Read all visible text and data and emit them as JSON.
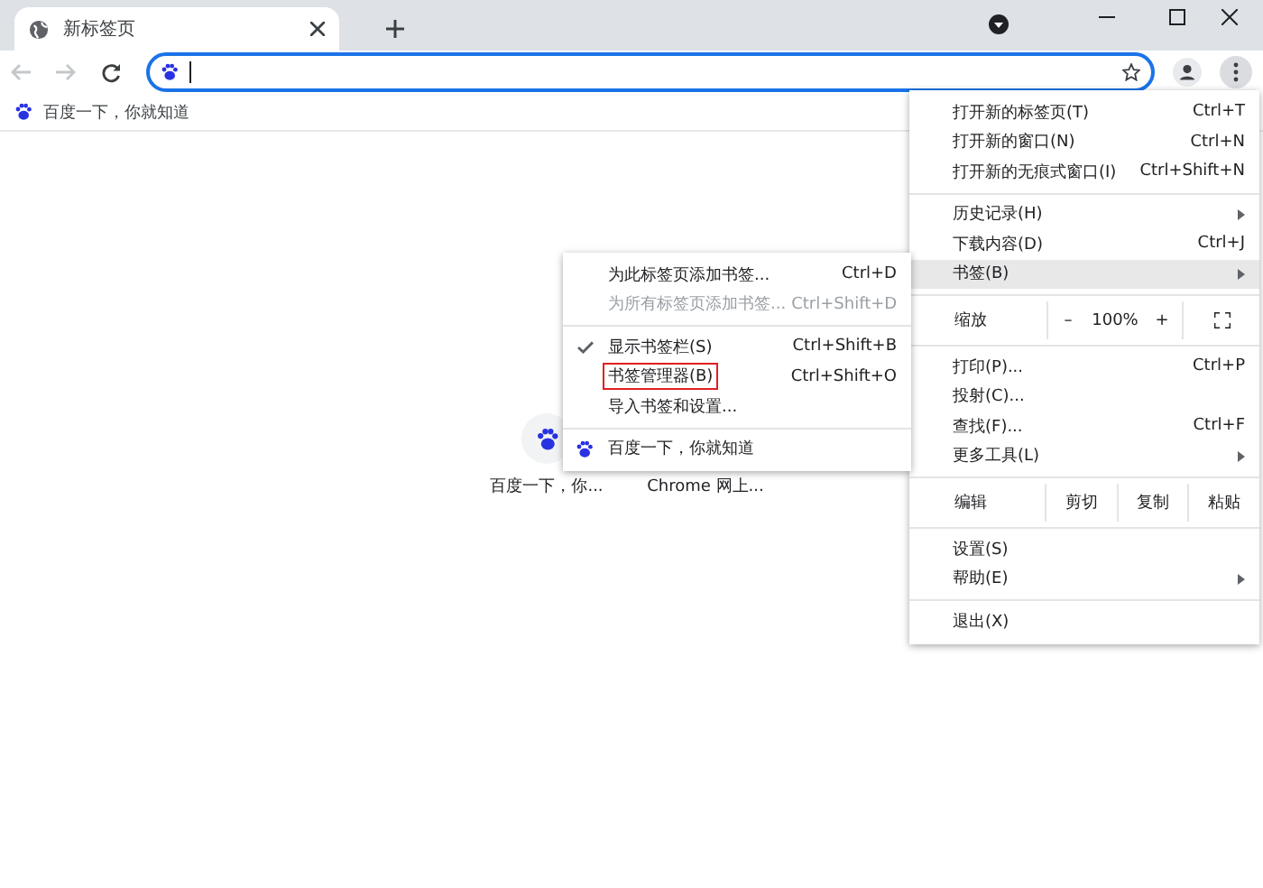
{
  "tabs": [
    {
      "title": "新标签页",
      "selected": true
    }
  ],
  "bookmarks_bar": [
    {
      "label": "百度一下，你就知道"
    }
  ],
  "shortcuts": [
    {
      "label": "百度一下，你...",
      "kind": "baidu"
    },
    {
      "label": "Chrome 网上...",
      "kind": "covered"
    }
  ],
  "main_menu": {
    "groups": [
      [
        {
          "kind": "item",
          "label": "打开新的标签页(T)",
          "shortcut": "Ctrl+T",
          "submenu": false,
          "highlighted": false
        },
        {
          "kind": "item",
          "label": "打开新的窗口(N)",
          "shortcut": "Ctrl+N",
          "submenu": false,
          "highlighted": false
        },
        {
          "kind": "item",
          "label": "打开新的无痕式窗口(I)",
          "shortcut": "Ctrl+Shift+N",
          "submenu": false,
          "highlighted": false
        }
      ],
      [
        {
          "kind": "item",
          "label": "历史记录(H)",
          "submenu": true,
          "highlighted": false
        },
        {
          "kind": "item",
          "label": "下载内容(D)",
          "shortcut": "Ctrl+J",
          "submenu": false,
          "highlighted": false
        },
        {
          "kind": "item",
          "label": "书签(B)",
          "submenu": true,
          "highlighted": true
        }
      ],
      [
        {
          "kind": "zoom",
          "label": "缩放",
          "minus": "–",
          "value": "100%",
          "plus": "+"
        }
      ],
      [
        {
          "kind": "item",
          "label": "打印(P)...",
          "shortcut": "Ctrl+P",
          "submenu": false,
          "highlighted": false
        },
        {
          "kind": "item",
          "label": "投射(C)...",
          "submenu": false,
          "highlighted": false
        },
        {
          "kind": "item",
          "label": "查找(F)...",
          "shortcut": "Ctrl+F",
          "submenu": false,
          "highlighted": false
        },
        {
          "kind": "item",
          "label": "更多工具(L)",
          "submenu": true,
          "highlighted": false
        }
      ],
      [
        {
          "kind": "edit",
          "label": "编辑",
          "buttons": [
            "剪切",
            "复制",
            "粘贴"
          ]
        }
      ],
      [
        {
          "kind": "item",
          "label": "设置(S)",
          "submenu": false,
          "highlighted": false
        },
        {
          "kind": "item",
          "label": "帮助(E)",
          "submenu": true,
          "highlighted": false
        }
      ],
      [
        {
          "kind": "item",
          "label": "退出(X)",
          "submenu": false,
          "highlighted": false
        }
      ]
    ]
  },
  "bookmarks_submenu": {
    "groups": [
      [
        {
          "kind": "item",
          "label": "为此标签页添加书签...",
          "shortcut": "Ctrl+D",
          "disabled": false,
          "checked": false,
          "outlined": false
        },
        {
          "kind": "item",
          "label": "为所有标签页添加书签...",
          "shortcut": "Ctrl+Shift+D",
          "disabled": true,
          "checked": false,
          "outlined": false
        }
      ],
      [
        {
          "kind": "item",
          "label": "显示书签栏(S)",
          "shortcut": "Ctrl+Shift+B",
          "disabled": false,
          "checked": true,
          "outlined": false
        },
        {
          "kind": "item",
          "label": "书签管理器(B)",
          "shortcut": "Ctrl+Shift+O",
          "disabled": false,
          "checked": false,
          "outlined": true
        },
        {
          "kind": "item",
          "label": "导入书签和设置...",
          "disabled": false,
          "checked": false,
          "outlined": false
        }
      ],
      [
        {
          "kind": "bookmark",
          "label": "百度一下，你就知道"
        }
      ]
    ]
  }
}
